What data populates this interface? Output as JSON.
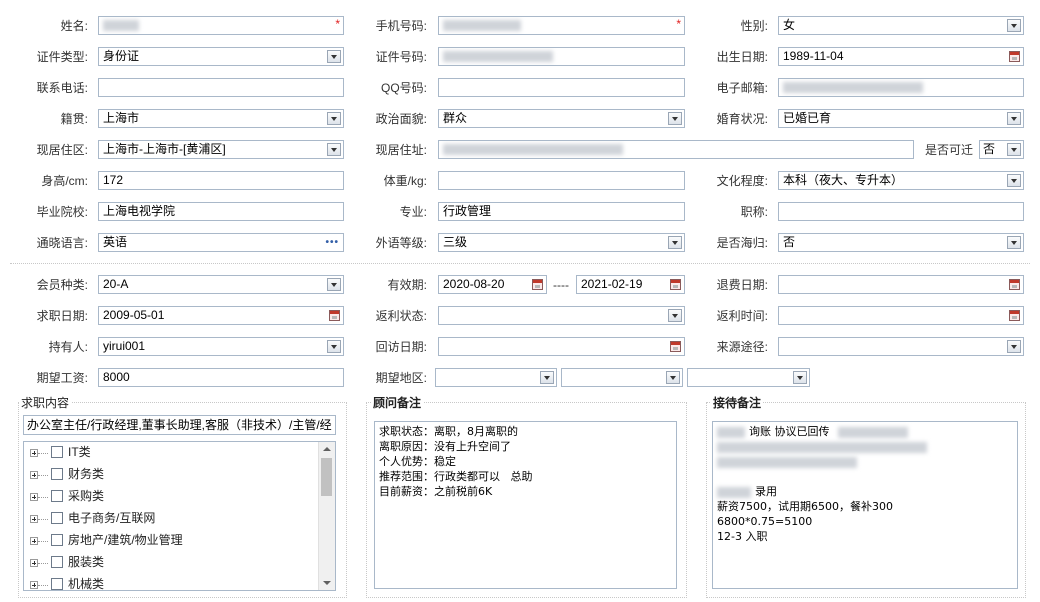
{
  "basic": {
    "name_label": "姓名:",
    "mobile_label": "手机号码:",
    "gender_label": "性别:",
    "gender_value": "女",
    "id_type_label": "证件类型:",
    "id_type_value": "身份证",
    "id_number_label": "证件号码:",
    "birth_label": "出生日期:",
    "birth_value": "1989-11-04",
    "phone_label": "联系电话:",
    "qq_label": "QQ号码:",
    "email_label": "电子邮箱:",
    "origin_label": "籍贯:",
    "origin_value": "上海市",
    "politics_label": "政治面貌:",
    "politics_value": "群众",
    "marital_label": "婚育状况:",
    "marital_value": "已婚已育",
    "residence_label": "现居住区:",
    "residence_value": "上海市-上海市-[黄浦区]",
    "address_label": "现居住址:",
    "relocate_label": "是否可迁",
    "relocate_value": "否",
    "height_label": "身高/cm:",
    "height_value": "172",
    "weight_label": "体重/kg:",
    "weight_value": "",
    "education_label": "文化程度:",
    "education_value": "本科（夜大、专升本）",
    "school_label": "毕业院校:",
    "school_value": "上海电视学院",
    "major_label": "专业:",
    "major_value": "行政管理",
    "title_label": "职称:",
    "title_value": "",
    "language_label": "通晓语言:",
    "language_value": "英语",
    "language_level_label": "外语等级:",
    "language_level_value": "三级",
    "overseas_label": "是否海归:",
    "overseas_value": "否"
  },
  "member": {
    "type_label": "会员种类:",
    "type_value": "20-A",
    "validity_label": "有效期:",
    "validity_from": "2020-08-20",
    "validity_sep": "----",
    "validity_to": "2021-02-19",
    "refund_date_label": "退费日期:",
    "job_date_label": "求职日期:",
    "job_date_value": "2009-05-01",
    "rebate_status_label": "返利状态:",
    "rebate_time_label": "返利时间:",
    "holder_label": "持有人:",
    "holder_value": "yirui001",
    "visit_date_label": "回访日期:",
    "source_label": "来源途径:",
    "salary_label": "期望工资:",
    "salary_value": "8000",
    "region_label": "期望地区:"
  },
  "job_panel": {
    "title": "求职内容",
    "selected": "办公室主任/行政经理,董事长助理,客服（非技术）/主管/经",
    "categories": [
      "IT类",
      "财务类",
      "采购类",
      "电子商务/互联网",
      "房地产/建筑/物业管理",
      "服装类",
      "机械类"
    ]
  },
  "advisor_panel": {
    "title": "顾问备注",
    "lines": [
      "求职状态：离职，8月离职的",
      "离职原因：没有上升空间了",
      "个人优势：稳定",
      "推荐范围：行政类都可以   总助",
      "目前薪资：之前税前6K"
    ]
  },
  "reception_panel": {
    "title": "接待备注",
    "line1": "询账 协议已回传",
    "line2": "录用",
    "line3": "薪资7500，试用期6500，餐补300",
    "line4": "6800*0.75=5100",
    "line5": "12-3 入职"
  }
}
